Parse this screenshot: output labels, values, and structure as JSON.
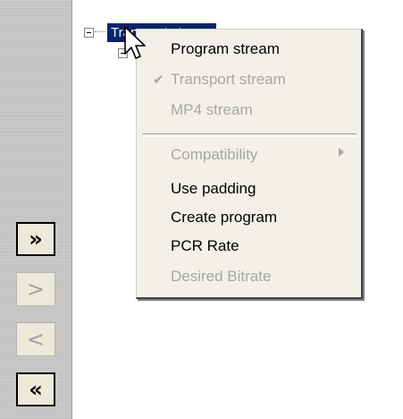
{
  "tree": {
    "selected_node_label": "Transport stream"
  },
  "side_buttons": [
    {
      "label": "»",
      "enabled": true
    },
    {
      "label": ">",
      "enabled": false
    },
    {
      "label": "<",
      "enabled": false
    },
    {
      "label": "«",
      "enabled": true
    }
  ],
  "context_menu": {
    "items": [
      {
        "label": "Program stream",
        "enabled": true
      },
      {
        "label": "Transport stream",
        "enabled": false,
        "checked": true
      },
      {
        "label": "MP4 stream",
        "enabled": false
      },
      {
        "label": "Compatibility",
        "enabled": false,
        "has_submenu": true
      },
      {
        "label": "Use padding",
        "enabled": true
      },
      {
        "label": "Create program",
        "enabled": true
      },
      {
        "label": "PCR Rate",
        "enabled": true
      },
      {
        "label": "Desired Bitrate",
        "enabled": false
      }
    ],
    "check_glyph": "✔"
  },
  "colors": {
    "selection": "#0a246a",
    "menu_background": "#f2f0e8",
    "disabled_text": "#a6a6a6"
  }
}
